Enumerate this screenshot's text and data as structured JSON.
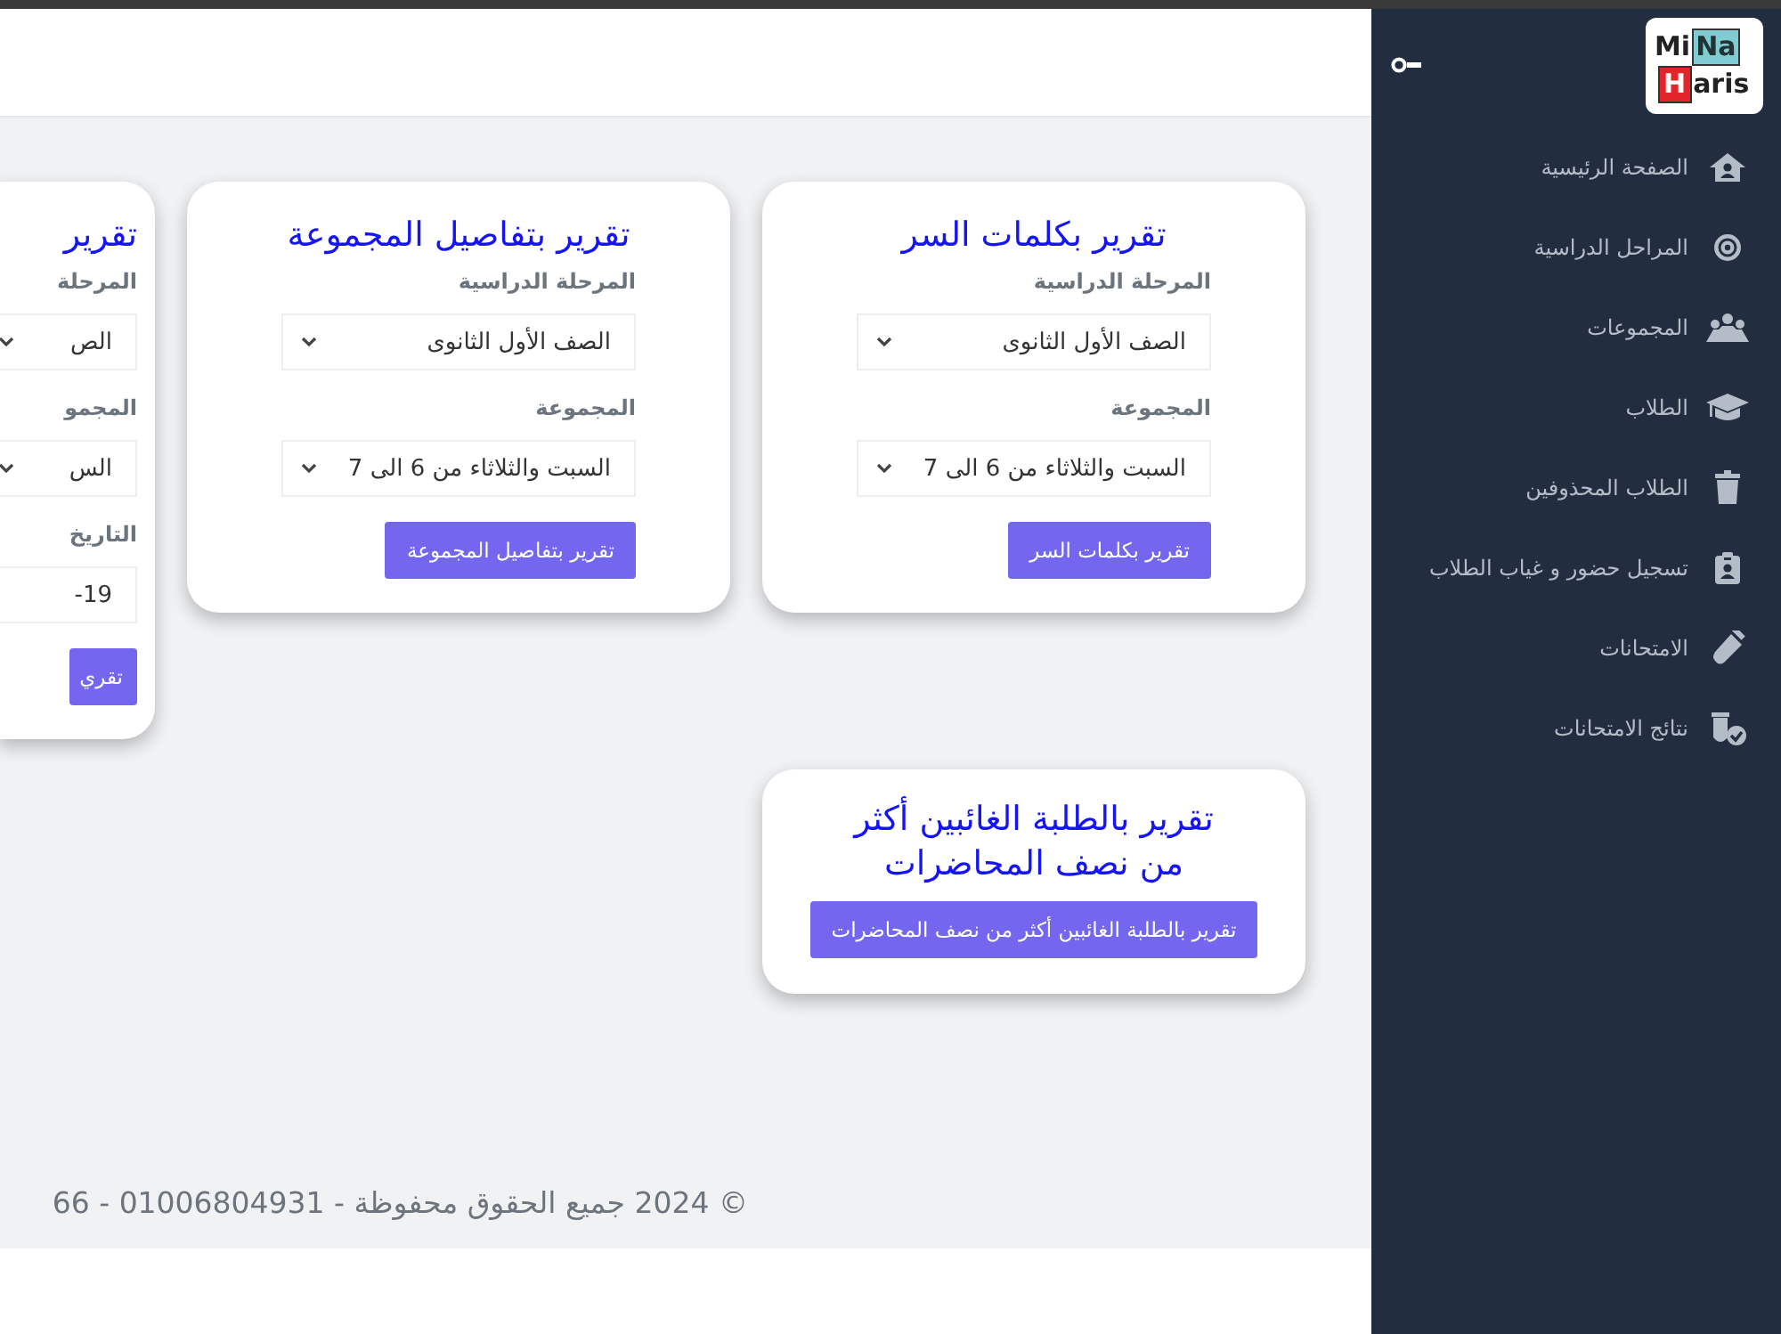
{
  "sidebar": {
    "logo": {
      "first_line_text": "Mi",
      "first_line_boxed": "Na",
      "second_line_boxed": "H",
      "second_line_text": "aris"
    },
    "items": [
      {
        "label": "الصفحة الرئيسية"
      },
      {
        "label": "المراحل الدراسية"
      },
      {
        "label": "المجموعات"
      },
      {
        "label": "الطلاب"
      },
      {
        "label": "الطلاب المحذوفين"
      },
      {
        "label": "تسجيل حضور و غياب الطلاب"
      },
      {
        "label": "الامتحانات"
      },
      {
        "label": "نتائج الامتحانات"
      }
    ]
  },
  "report_rows": [
    [
      {
        "title": "تقرير بكلمات السر",
        "fields": [
          {
            "label": "المرحلة الدراسية",
            "value": "الصف الأول الثانوى",
            "kind": "select"
          },
          {
            "label": "المجموعة",
            "value": "السبت والثلاثاء من 6 الى 7",
            "kind": "select"
          }
        ],
        "button": "تقرير بكلمات السر"
      },
      {
        "title": "تقرير بتفاصيل المجموعة",
        "fields": [
          {
            "label": "المرحلة الدراسية",
            "value": "الصف الأول الثانوى",
            "kind": "select"
          },
          {
            "label": "المجموعة",
            "value": "السبت والثلاثاء من 6 الى 7",
            "kind": "select"
          }
        ],
        "button": "تقرير بتفاصيل المجموعة"
      },
      {
        "title": "تقرير",
        "fields": [
          {
            "label": "المرحلة",
            "value": "الص",
            "kind": "select"
          },
          {
            "label": "المجمو",
            "value": "الس",
            "kind": "select"
          },
          {
            "label": "التاريخ",
            "value": "-19",
            "kind": "date"
          }
        ],
        "button": "تقري"
      }
    ],
    [
      {
        "title": "تقرير بالطلبة الغائبين أكثر من نصف المحاضرات",
        "button": "تقرير بالطلبة الغائبين أكثر من نصف المحاضرات"
      }
    ]
  ],
  "footer": "© 2024 جميع الحقوق محفوظة - 01006804931 - 66"
}
